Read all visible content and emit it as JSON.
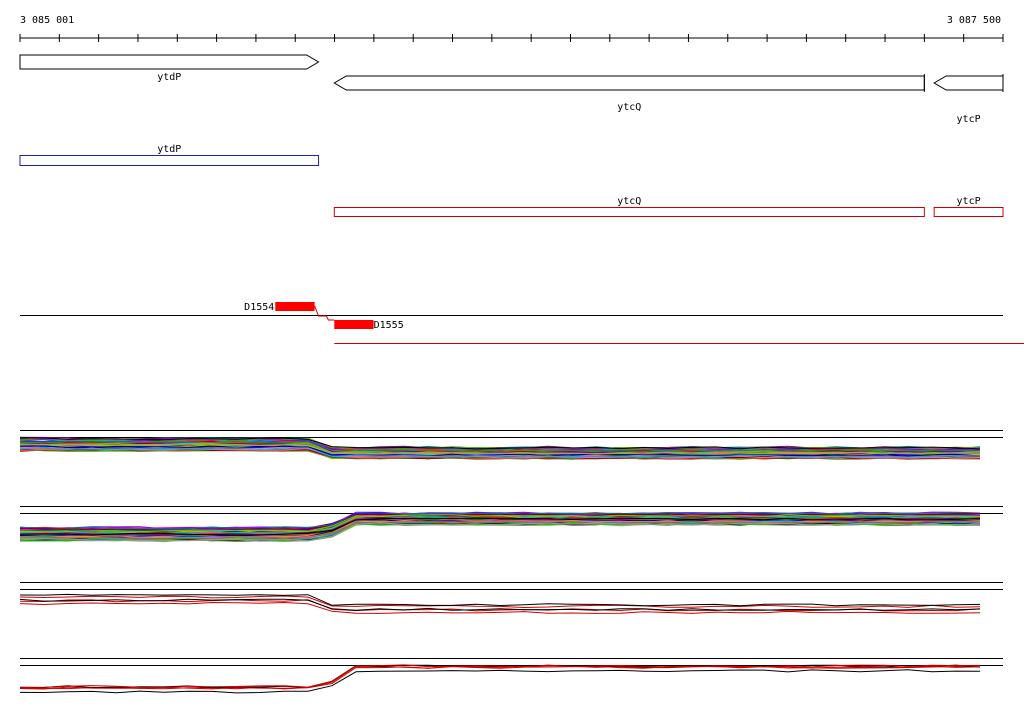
{
  "ruler": {
    "start_label": "3 085 001",
    "end_label": "3 087 500",
    "start": 3085001,
    "end": 3087500
  },
  "genes": [
    {
      "name": "ytdP",
      "start": 3085001,
      "end": 3085760,
      "strand": "+"
    },
    {
      "name": "ytcQ",
      "start": 3085800,
      "end": 3087300,
      "strand": "-"
    },
    {
      "name": "ytcP",
      "start": 3087325,
      "end": 3087500,
      "strand": "-"
    }
  ],
  "transcripts_forward": [
    {
      "name": "ytdP",
      "start": 3085001,
      "end": 3085760
    }
  ],
  "transcripts_reverse": [
    {
      "name": "ytcQ",
      "start": 3085800,
      "end": 3087300
    },
    {
      "name": "ytcP",
      "start": 3087325,
      "end": 3087500
    }
  ],
  "features": [
    {
      "name": "D1554",
      "start": 3085650,
      "end": 3085750,
      "strand": "+"
    },
    {
      "name": "D1555",
      "start": 3085800,
      "end": 3085900,
      "strand": "-"
    }
  ],
  "colors": {
    "forward": "#1f1fbf",
    "reverse": "#cc0000",
    "feature": "#ff0000",
    "axis": "#000000"
  },
  "expression_panels": [
    {
      "id": "panel1",
      "left_level": 0.62,
      "right_level": 0.38,
      "step_position": 3085760,
      "direction": "down",
      "series_count": 60
    },
    {
      "id": "panel2",
      "left_level": 0.28,
      "right_level": 0.68,
      "step_position": 3085800,
      "direction": "up",
      "series_count": 60
    },
    {
      "id": "panel3",
      "left_level": 0.55,
      "right_level": 0.3,
      "step_position": 3085760,
      "direction": "down",
      "series_count": 5
    },
    {
      "id": "panel4",
      "left_level": 0.2,
      "right_level": 0.75,
      "step_position": 3085800,
      "direction": "up",
      "series_count": 5
    }
  ]
}
